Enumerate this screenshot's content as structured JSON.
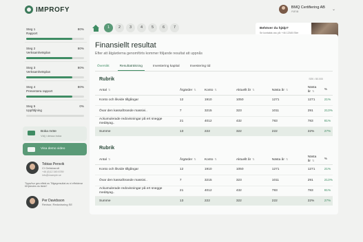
{
  "app": {
    "name": "IMPROFY"
  },
  "user": {
    "name": "BMQ Certifiering AB",
    "sub": "Anna"
  },
  "sidebar": {
    "steps": [
      {
        "label": "Steg 1\nRapport",
        "pct": "80%",
        "value": 80
      },
      {
        "label": "Steg 2\nVerksamhetsplan",
        "pct": "80%",
        "value": 80
      },
      {
        "label": "Steg 3\nVerksamhetsplan",
        "pct": "80%",
        "value": 80
      },
      {
        "label": "Steg 4\nPresentera rapport",
        "pct": "80%",
        "value": 80
      },
      {
        "label": "Steg 5\nUppföljning",
        "pct": "0%",
        "value": 0
      }
    ]
  },
  "cards": {
    "book": {
      "label": "Boka möte",
      "sub": "Välj i dessa boka"
    },
    "show": {
      "label": "Visa demo video"
    }
  },
  "contacts": [
    {
      "name": "Tobias Persvik",
      "role": "CI Gefakrandt",
      "line1": "+46 (0)12 345 6789",
      "line2": "info@example.se"
    },
    {
      "name": "Per Davidsson",
      "role": "Revisor, Redovisning SE"
    }
  ],
  "note": "Tipps/hur ges effekt av Tillgegresultat av ni effekterar till tjänstes du tävla?",
  "steps_nav": {
    "items": [
      "1",
      "2",
      "3",
      "4",
      "5",
      "6",
      "7"
    ],
    "active": 0
  },
  "promo": {
    "title": "Behöver du hjälp?",
    "text": "Se kontakta oss på: +46 12345 Eller mejla"
  },
  "main": {
    "title": "Finansiellt resultat",
    "subtitle": "Efter att åtgärderna genomförts kommer följande resultat att uppnås",
    "tabs": [
      "Översikt",
      "Resultaträkning",
      "Investering kapital",
      "Investering tid"
    ],
    "active_tab": 1,
    "pager": "SEK / 80.000",
    "tables": [
      {
        "title": "Rubrik",
        "headers": [
          "Antal",
          "Åtgärder",
          "Konto",
          "Aktuellt år",
          "Nästa år",
          "Nästa år",
          "%"
        ],
        "rows": [
          [
            "Konto och likvide tillgångar",
            "12",
            "1910",
            "1050",
            "1271",
            "1271",
            "21%"
          ],
          [
            "Övar den kassaförande massivi..",
            "7",
            "3215",
            "323",
            "1011",
            "291",
            "213%"
          ],
          [
            "Ackumulerade redovisningar på ert snegge medäyag..",
            "21",
            "4012",
            "432",
            "783",
            "783",
            "81%"
          ]
        ],
        "sum": [
          "Summe",
          "13",
          "222",
          "322",
          "222",
          "22%",
          "27%"
        ]
      },
      {
        "title": "Rubrik",
        "headers": [
          "Antal",
          "Åtgärder",
          "Konto",
          "Aktuellt år",
          "Nästa år",
          "Nästa år",
          "%"
        ],
        "rows": [
          [
            "Konto och likvide tillgångar",
            "12",
            "1910",
            "1050",
            "1271",
            "1271",
            "21%"
          ],
          [
            "Övar den kassaförande massivi..",
            "7",
            "3215",
            "323",
            "1011",
            "291",
            "213%"
          ],
          [
            "Ackumulerade redovisningar på ert snegge medäyag..",
            "21",
            "4012",
            "432",
            "783",
            "783",
            "81%"
          ]
        ],
        "sum": [
          "Summe",
          "13",
          "222",
          "322",
          "222",
          "22%",
          "27%"
        ]
      }
    ]
  },
  "colors": {
    "accent": "#3e8c63",
    "accent_light": "#5a9a77",
    "bg": "#f1f2f0",
    "sum_row": "#e5ece6"
  }
}
